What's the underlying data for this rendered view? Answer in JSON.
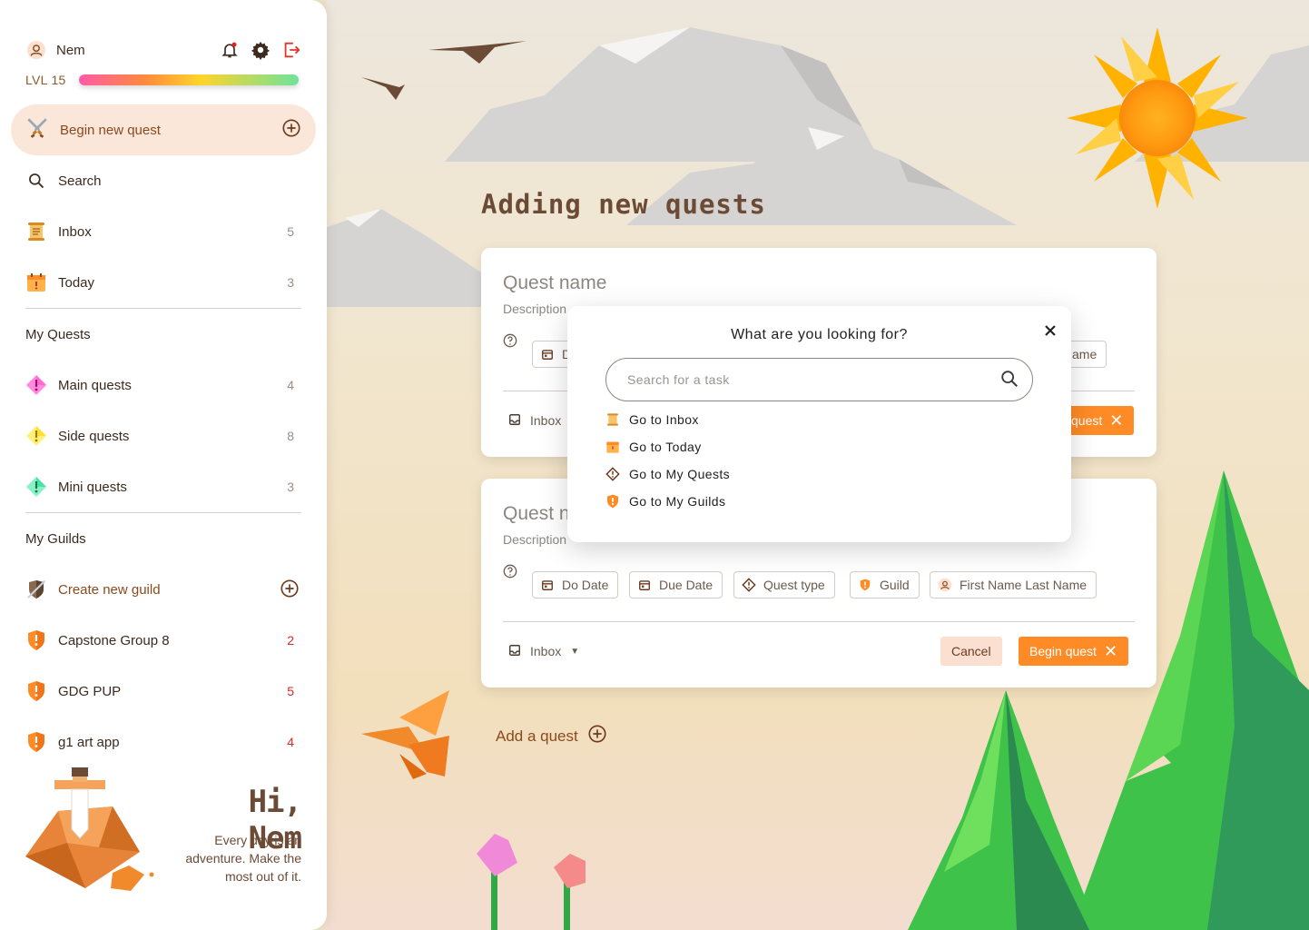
{
  "user": {
    "name": "Nem",
    "level_label": "LVL 15"
  },
  "sidebar": {
    "begin_quest_label": "Begin new quest",
    "search_label": "Search",
    "inbox": {
      "label": "Inbox",
      "count": "5"
    },
    "today": {
      "label": "Today",
      "count": "3"
    },
    "my_quests_title": "My Quests",
    "quests": [
      {
        "label": "Main quests",
        "count": "4",
        "color": "#ff6ad5"
      },
      {
        "label": "Side quests",
        "count": "8",
        "color": "#ffe033"
      },
      {
        "label": "Mini quests",
        "count": "3",
        "color": "#4fe0a6"
      }
    ],
    "my_guilds_title": "My Guilds",
    "create_guild_label": "Create new guild",
    "guilds": [
      {
        "label": "Capstone Group 8",
        "count": "2"
      },
      {
        "label": "GDG PUP",
        "count": "5"
      },
      {
        "label": "g1 art app",
        "count": "4"
      }
    ],
    "greeting_title": "Hi, Nem",
    "greeting_sub": "Every day is an adventure. Make the most out of it."
  },
  "main": {
    "page_title": "Adding new quests",
    "card1": {
      "quest_name": "Quest name",
      "description": "Description",
      "chip_partial": "D",
      "chip_assignee_partial": "ame",
      "inbox_label": "Inbox",
      "begin_partial": "quest"
    },
    "card2": {
      "quest_name": "Quest name",
      "description": "Description",
      "chips": {
        "do_date": "Do Date",
        "due_date": "Due Date",
        "quest_type": "Quest type",
        "guild": "Guild",
        "assignee": "First Name Last Name"
      },
      "inbox_label": "Inbox",
      "cancel_label": "Cancel",
      "begin_label": "Begin quest"
    },
    "add_quest_label": "Add a quest"
  },
  "modal": {
    "title": "What are you looking for?",
    "search_placeholder": "Search for a task",
    "goto": [
      {
        "label": "Go to Inbox",
        "icon": "scroll-icon"
      },
      {
        "label": "Go to Today",
        "icon": "calendar-icon"
      },
      {
        "label": "Go to My Quests",
        "icon": "quest-diamond-icon"
      },
      {
        "label": "Go to My Guilds",
        "icon": "guild-shield-icon"
      }
    ]
  },
  "colors": {
    "accent": "#ff8b26",
    "brand_brown": "#8a4a1e",
    "sidebar_bg": "#ffffff",
    "page_bg": "#efe3cc"
  }
}
